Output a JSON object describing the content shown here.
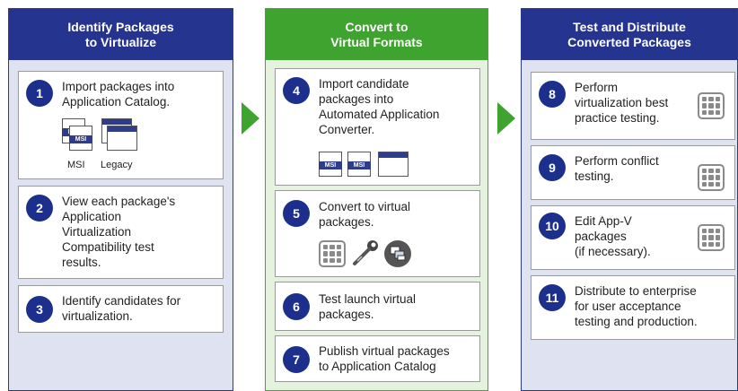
{
  "columns": [
    {
      "title": "Identify Packages\nto Virtualize"
    },
    {
      "title": "Convert to\nVirtual Formats"
    },
    {
      "title": "Test and Distribute\nConverted Packages"
    }
  ],
  "steps": [
    {
      "num": "1",
      "text": "Import packages into\nApplication Catalog."
    },
    {
      "num": "2",
      "text": "View each package's\nApplication\nVirtualization\nCompatibility test\nresults."
    },
    {
      "num": "3",
      "text": "Identify candidates for\nvirtualization."
    },
    {
      "num": "4",
      "text": "Import candidate\npackages into\nAutomated Application\nConverter."
    },
    {
      "num": "5",
      "text": "Convert to virtual\npackages."
    },
    {
      "num": "6",
      "text": "Test launch virtual\npackages."
    },
    {
      "num": "7",
      "text": "Publish virtual packages\nto Application Catalog"
    },
    {
      "num": "8",
      "text": "Perform\nvirtualization best\npractice testing."
    },
    {
      "num": "9",
      "text": "Perform conflict\ntesting."
    },
    {
      "num": "10",
      "text": "Edit App-V\npackages\n(if necessary)."
    },
    {
      "num": "11",
      "text": "Distribute to enterprise\nfor user acceptance\ntesting and production."
    }
  ],
  "icon_labels": {
    "msi": "MSI",
    "legacy": "Legacy",
    "msi_badge": "MSI"
  },
  "icons": [
    "msi-file-icon",
    "legacy-window-icon",
    "grid-icon",
    "wrench-icon",
    "virtual-package-icon"
  ],
  "colors": {
    "blue": "#25358f",
    "green": "#3ea42f",
    "blue_bg": "#dfe3f1",
    "green_bg": "#e5f3de"
  }
}
